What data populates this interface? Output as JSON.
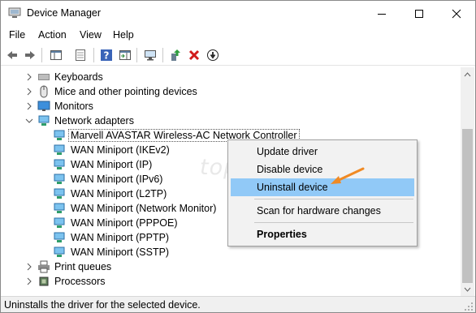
{
  "window": {
    "title": "Device Manager",
    "controls": {
      "minimize": "minimize",
      "maximize": "maximize",
      "close": "close"
    }
  },
  "menu": [
    "File",
    "Action",
    "View",
    "Help"
  ],
  "toolbar": {
    "icons": [
      "back-arrow-icon",
      "forward-arrow-icon",
      "show-hide-console-tree-icon",
      "properties-icon",
      "help-icon",
      "action-pane-icon",
      "scan-hardware-icon",
      "update-driver-icon",
      "uninstall-icon",
      "disable-device-icon"
    ]
  },
  "tree": [
    {
      "label": "Keyboards",
      "state": "collapsed",
      "icon": "keyboard-icon",
      "level": 1
    },
    {
      "label": "Mice and other pointing devices",
      "state": "collapsed",
      "icon": "mouse-icon",
      "level": 1
    },
    {
      "label": "Monitors",
      "state": "collapsed",
      "icon": "monitor-icon",
      "level": 1
    },
    {
      "label": "Network adapters",
      "state": "expanded",
      "icon": "network-adapter-icon",
      "level": 1
    },
    {
      "label": "Marvell AVASTAR Wireless-AC Network Controller",
      "state": "focused",
      "icon": "network-adapter-icon",
      "level": 2
    },
    {
      "label": "WAN Miniport (IKEv2)",
      "icon": "network-adapter-icon",
      "level": 2
    },
    {
      "label": "WAN Miniport (IP)",
      "icon": "network-adapter-icon",
      "level": 2
    },
    {
      "label": "WAN Miniport (IPv6)",
      "icon": "network-adapter-icon",
      "level": 2
    },
    {
      "label": "WAN Miniport (L2TP)",
      "icon": "network-adapter-icon",
      "level": 2
    },
    {
      "label": "WAN Miniport (Network Monitor)",
      "icon": "network-adapter-icon",
      "level": 2
    },
    {
      "label": "WAN Miniport (PPPOE)",
      "icon": "network-adapter-icon",
      "level": 2
    },
    {
      "label": "WAN Miniport (PPTP)",
      "icon": "network-adapter-icon",
      "level": 2
    },
    {
      "label": "WAN Miniport (SSTP)",
      "icon": "network-adapter-icon",
      "level": 2
    },
    {
      "label": "Print queues",
      "state": "collapsed",
      "icon": "printer-icon",
      "level": 1
    },
    {
      "label": "Processors",
      "state": "collapsed",
      "icon": "processor-icon",
      "level": 1
    }
  ],
  "context_menu": {
    "items": [
      {
        "label": "Update driver"
      },
      {
        "label": "Disable device"
      },
      {
        "label": "Uninstall device",
        "highlighted": true
      },
      {
        "label": "Scan for hardware changes"
      },
      {
        "label": "Properties",
        "bold": true
      }
    ]
  },
  "watermark": "top-password.com",
  "status": "Uninstalls the driver for the selected device.",
  "colors": {
    "highlight": "#91c9f7",
    "annotation_arrow": "#f08a24",
    "menu_bg": "#f2f2f2",
    "status_bg": "#f0f0f0"
  }
}
